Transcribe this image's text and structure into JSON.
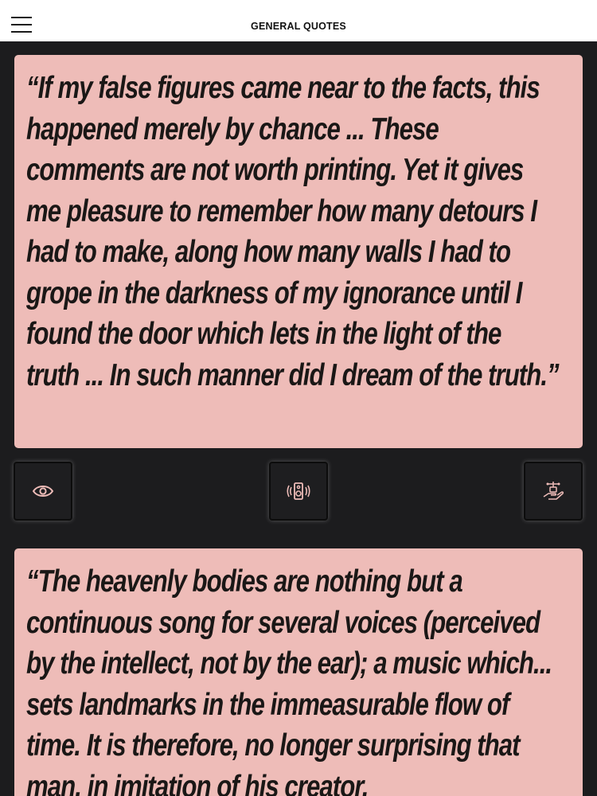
{
  "header": {
    "title": "GENERAL QUOTES"
  },
  "quotes": [
    {
      "text": "“If my false figures came near to the facts, this happened merely by chance ... These comments are not worth printing. Yet it gives me pleasure to remember how many detours I had to make, along how many walls I had to grope in the darkness of my ignorance until I found the door which lets in the light of the truth ... In such manner did I dream of the truth.”"
    },
    {
      "text": "“The heavenly bodies are nothing but a continuous song for several voices (perceived by the intellect, not by the ear); a music which... sets landmarks in the immeasurable flow of time. It is therefore, no longer surprising that man, in imitation of his creator,"
    }
  ],
  "actions": [
    {
      "icon": "eye-icon"
    },
    {
      "icon": "speaker-icon"
    },
    {
      "icon": "share-hand-icon"
    }
  ],
  "colors": {
    "background": "#1c1c1e",
    "card": "#eebcb8",
    "text": "#1a1716",
    "header": "#ffffff"
  }
}
